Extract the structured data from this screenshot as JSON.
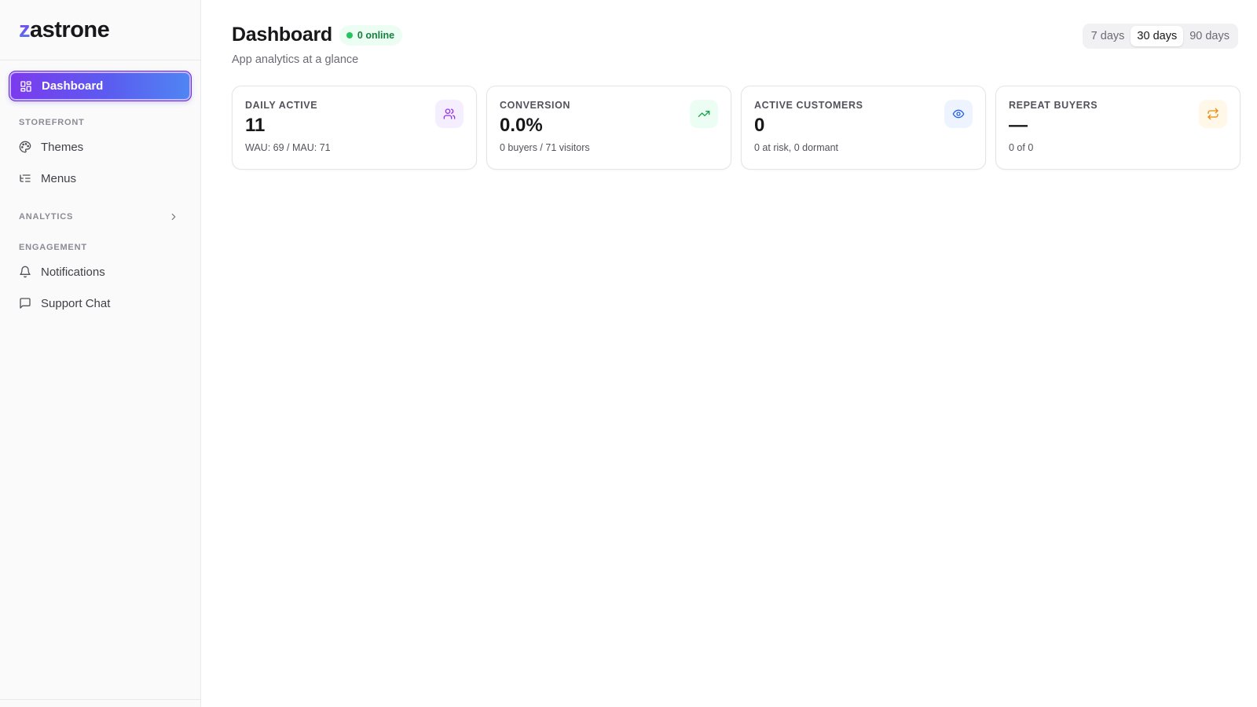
{
  "brand": {
    "first_letter": "z",
    "rest": "astrone"
  },
  "sidebar": {
    "active": {
      "label": "Dashboard",
      "icon": "dashboard-grid-icon"
    },
    "sections": [
      {
        "label": "STOREFRONT",
        "items": [
          {
            "label": "Themes",
            "icon": "palette-icon"
          },
          {
            "label": "Menus",
            "icon": "list-tree-icon"
          }
        ]
      },
      {
        "label": "ANALYTICS",
        "collapsed": true,
        "items": []
      },
      {
        "label": "ENGAGEMENT",
        "items": [
          {
            "label": "Notifications",
            "icon": "bell-icon"
          },
          {
            "label": "Support Chat",
            "icon": "chat-bubble-icon"
          }
        ]
      }
    ]
  },
  "header": {
    "title": "Dashboard",
    "online_badge": "0 online",
    "subtitle": "App analytics at a glance"
  },
  "range": {
    "options": [
      "7 days",
      "30 days",
      "90 days"
    ],
    "selected": "30 days"
  },
  "cards": [
    {
      "label": "DAILY ACTIVE",
      "value": "11",
      "sub": "WAU: 69 / MAU: 71",
      "icon": "users-icon",
      "icon_color": "#9333ea",
      "icon_bg": "#f5eefe"
    },
    {
      "label": "CONVERSION",
      "value": "0.0%",
      "sub": "0 buyers / 71 visitors",
      "icon": "trending-up-icon",
      "icon_color": "#16a34a",
      "icon_bg": "#ecfdf3"
    },
    {
      "label": "ACTIVE CUSTOMERS",
      "value": "0",
      "sub": "0 at risk, 0 dormant",
      "icon": "eye-icon",
      "icon_color": "#2563eb",
      "icon_bg": "#eef4ff"
    },
    {
      "label": "REPEAT BUYERS",
      "value": "—",
      "sub": "0 of 0",
      "icon": "repeat-icon",
      "icon_color": "#ea8a0c",
      "icon_bg": "#fff7e8"
    }
  ],
  "colors": {
    "accent_gradient_start": "#7c3aed",
    "accent_gradient_end": "#4f86f3",
    "online_green": "#22c55e"
  }
}
